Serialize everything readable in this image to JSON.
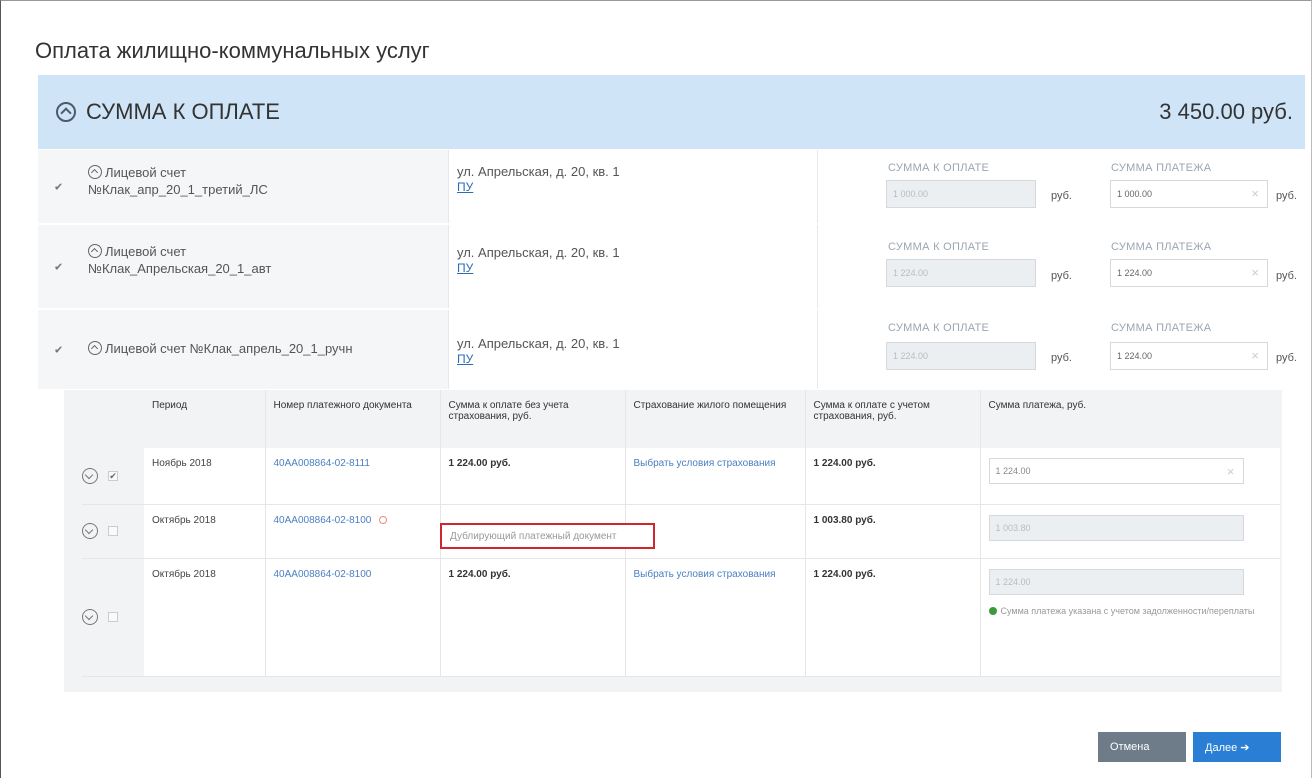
{
  "page": {
    "title": "Оплата жилищно-коммунальных услуг"
  },
  "summary": {
    "title": "СУММА К ОПЛАТЕ",
    "total": "3 450.00 руб."
  },
  "accounts": [
    {
      "name_line1": "Лицевой счет",
      "name_line2": "№Клак_апр_20_1_третий_ЛС",
      "address": "ул. Апрельская, д. 20, кв. 1",
      "pu": "ПУ",
      "due_label": "СУММА К ОПЛАТЕ",
      "due_value": "1 000.00",
      "pay_label": "СУММА ПЛАТЕЖА",
      "pay_value": "1 000.00",
      "currency": "руб."
    },
    {
      "name_line1": "Лицевой счет",
      "name_line2": "№Клак_Апрельская_20_1_авт",
      "address": "ул. Апрельская, д. 20, кв. 1",
      "pu": "ПУ",
      "due_label": "СУММА К ОПЛАТЕ",
      "due_value": "1 224.00",
      "pay_label": "СУММА ПЛАТЕЖА",
      "pay_value": "1 224.00",
      "currency": "руб."
    },
    {
      "name_line1": "Лицевой счет №Клак_апрель_20_1_ручн",
      "name_line2": "",
      "address": "ул. Апрельская, д. 20, кв. 1",
      "pu": "ПУ",
      "due_label": "СУММА К ОПЛАТЕ",
      "due_value": "1 224.00",
      "pay_label": "СУММА ПЛАТЕЖА",
      "pay_value": "1 224.00",
      "currency": "руб."
    }
  ],
  "detail": {
    "headers": {
      "period": "Период",
      "doc_number": "Номер платежного документа",
      "sum_no_ins": "Сумма к оплате без учета страхования, руб.",
      "insurance": "Страхование жилого помещения",
      "sum_with_ins": "Сумма к оплате с учетом страхования, руб.",
      "payment": "Сумма платежа, руб."
    },
    "rows": [
      {
        "period": "Ноябрь 2018",
        "doc_number": "40АА008864-02-8111",
        "sum_no_ins": "1 224.00 руб.",
        "insurance": "Выбрать условия страхования",
        "sum_with_ins": "1 224.00 руб.",
        "payment": "1 224.00"
      },
      {
        "period": "Октябрь 2018",
        "doc_number": "40АА008864-02-8100",
        "sum_no_ins": "",
        "insurance": "",
        "sum_with_ins": "1 003.80 руб.",
        "payment": "1 003.80"
      },
      {
        "period": "Октябрь 2018",
        "doc_number": "40АА008864-02-8100",
        "sum_no_ins": "1 224.00 руб.",
        "insurance": "Выбрать условия страхования",
        "sum_with_ins": "1 224.00 руб.",
        "payment": "1 224.00",
        "note": "Сумма платежа указана с учетом задолженности/переплаты"
      }
    ],
    "error_text": "Дублирующий платежный документ"
  },
  "buttons": {
    "cancel": "Отмена",
    "next": "Далее ➔"
  }
}
